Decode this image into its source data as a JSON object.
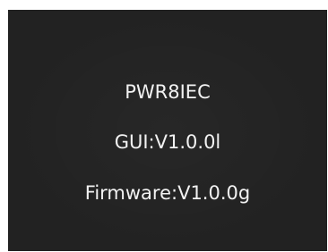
{
  "about": {
    "model": "PWR8IEC",
    "gui_version": "GUI:V1.0.0l",
    "firmware_version": "Firmware:V1.0.0g"
  },
  "colors": {
    "panel_background": "#222222",
    "text": "#f2f2f2",
    "outer_background": "#ffffff"
  }
}
